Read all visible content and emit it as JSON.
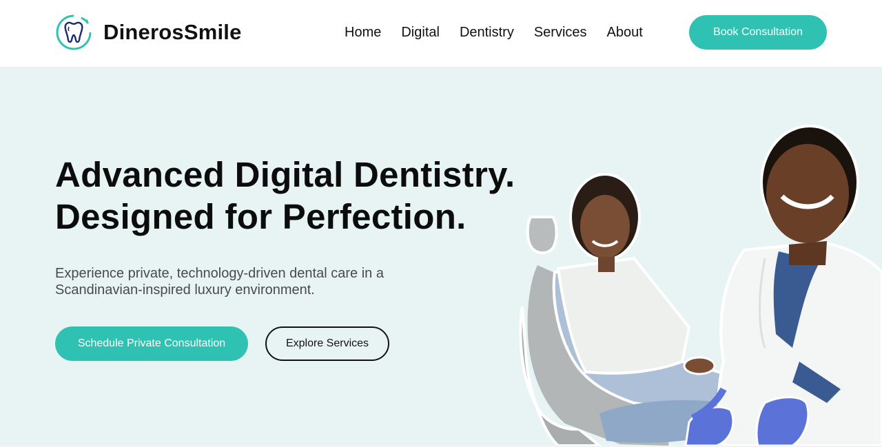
{
  "brand": {
    "name": "DinerosSmile",
    "logo_icon": "tooth-icon"
  },
  "nav": {
    "items": [
      {
        "label": "Home"
      },
      {
        "label": "Digital"
      },
      {
        "label": "Dentistry"
      },
      {
        "label": "Services"
      },
      {
        "label": "About"
      }
    ],
    "cta_label": "Book Consultation"
  },
  "hero": {
    "headline_line1": "Advanced Digital Dentistry.",
    "headline_line2": "Designed for Perfection.",
    "subtext_line1": "Experience private, technology-driven dental care in a",
    "subtext_line2": "Scandinavian-inspired luxury environment.",
    "primary_cta": "Schedule Private Consultation",
    "secondary_cta": "Explore Services",
    "image_icon": "dentist-patient-photo"
  },
  "colors": {
    "accent": "#2fc2b2",
    "hero_bg": "#e8f4f4",
    "text": "#111111"
  }
}
